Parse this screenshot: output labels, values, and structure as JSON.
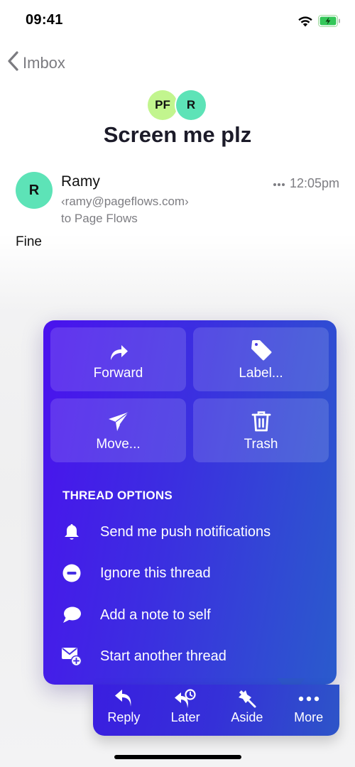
{
  "status_bar": {
    "time": "09:41",
    "wifi_icon": "wifi-icon",
    "battery_icon": "battery-charging-icon"
  },
  "nav": {
    "back_label": "Imbox",
    "back_icon": "chevron-left-icon"
  },
  "thread": {
    "participants": [
      {
        "initials": "PF",
        "color": "#c2f58e"
      },
      {
        "initials": "R",
        "color": "#5de3b7"
      }
    ],
    "subject": "Screen me plz"
  },
  "message": {
    "avatar_initial": "R",
    "avatar_color": "#5de3b7",
    "sender_name": "Ramy",
    "sender_email": "‹ramy@pageflows.com›",
    "recipient": "to Page Flows",
    "more_icon": "ellipsis-icon",
    "time": "12:05pm",
    "body": "Fine"
  },
  "menu": {
    "gradient": [
      "#4a12ee",
      "#2a5bcc"
    ],
    "tiles": [
      {
        "label": "Forward",
        "icon": "forward-arrow-icon"
      },
      {
        "label": "Label...",
        "icon": "tag-icon"
      },
      {
        "label": "Move...",
        "icon": "paper-plane-icon"
      },
      {
        "label": "Trash",
        "icon": "trash-icon"
      }
    ],
    "section_title": "THREAD OPTIONS",
    "options": [
      {
        "label": "Send me push notifications",
        "icon": "bell-icon"
      },
      {
        "label": "Ignore this thread",
        "icon": "minus-circle-icon"
      },
      {
        "label": "Add a note to self",
        "icon": "speech-bubble-icon"
      },
      {
        "label": "Start another thread",
        "icon": "envelope-plus-icon"
      }
    ]
  },
  "toolbar": {
    "items": [
      {
        "label": "Reply",
        "icon": "reply-icon"
      },
      {
        "label": "Later",
        "icon": "reply-later-clock-icon"
      },
      {
        "label": "Aside",
        "icon": "pin-icon"
      },
      {
        "label": "More",
        "icon": "more-dots-icon",
        "active": true
      }
    ]
  }
}
